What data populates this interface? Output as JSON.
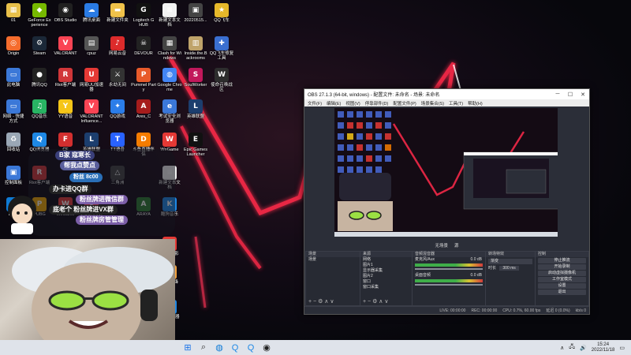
{
  "desktop": {
    "icons": [
      {
        "label": "01",
        "color": "#e8c04a",
        "glyph": "▦"
      },
      {
        "label": "GeForce Experience",
        "color": "#76b900",
        "glyph": "◆"
      },
      {
        "label": "OBS Studio",
        "color": "#202020",
        "glyph": "◉"
      },
      {
        "label": "腾讯桌面",
        "color": "#2a7be4",
        "glyph": "☁"
      },
      {
        "label": "新建文件夹",
        "color": "#f0c24a",
        "glyph": "▬"
      },
      {
        "label": "Logitech G HUB",
        "color": "#111111",
        "glyph": "G"
      },
      {
        "label": "新建文本文档",
        "color": "#f2f2f2",
        "glyph": "≡"
      },
      {
        "label": "20220515...",
        "color": "#444444",
        "glyph": "▣"
      },
      {
        "label": "QQ飞车",
        "color": "#e6b82a",
        "glyph": "★"
      },
      {
        "label": "Origin",
        "color": "#f56c2d",
        "glyph": "◎"
      },
      {
        "label": "Steam",
        "color": "#1b2838",
        "glyph": "⚙"
      },
      {
        "label": "VALORANT",
        "color": "#fa4454",
        "glyph": "V"
      },
      {
        "label": "cpuz",
        "color": "#555555",
        "glyph": "▤"
      },
      {
        "label": "网易云音",
        "color": "#dd2b2b",
        "glyph": "♪"
      },
      {
        "label": "DEVOUR",
        "color": "#222222",
        "glyph": "☠"
      },
      {
        "label": "Clash for Windows",
        "color": "#444444",
        "glyph": "▦"
      },
      {
        "label": "Inside.the.Backrooms",
        "color": "#bfa36a",
        "glyph": "▥"
      },
      {
        "label": "QQ飞车修复工具",
        "color": "#3a6fd0",
        "glyph": "✚"
      },
      {
        "label": "此电脑",
        "color": "#3b78d8",
        "glyph": "▭"
      },
      {
        "label": "腾讯QQ",
        "color": "#222222",
        "glyph": "●"
      },
      {
        "label": "Riot客户端",
        "color": "#d13639",
        "glyph": "R"
      },
      {
        "label": "网易UU加速器",
        "color": "#e53935",
        "glyph": "U"
      },
      {
        "label": "永劫无间",
        "color": "#333333",
        "glyph": "⚔"
      },
      {
        "label": "Pummel Party",
        "color": "#e85a2a",
        "glyph": "P"
      },
      {
        "label": "Google Chrome",
        "color": "#4285f4",
        "glyph": "◍"
      },
      {
        "label": "SoulWorker",
        "color": "#c2185b",
        "glyph": "S"
      },
      {
        "label": "使命召唤战区",
        "color": "#2d2d2d",
        "glyph": "W"
      },
      {
        "label": "网络 - 快捷方式",
        "color": "#3b78d8",
        "glyph": "▭"
      },
      {
        "label": "QQ音乐",
        "color": "#28b463",
        "glyph": "♫"
      },
      {
        "label": "YY语音",
        "color": "#f5c518",
        "glyph": "Y"
      },
      {
        "label": "VALORANT Influence...",
        "color": "#fa4454",
        "glyph": "V"
      },
      {
        "label": "QQ游戏",
        "color": "#2b7de9",
        "glyph": "✦"
      },
      {
        "label": "Ares_C",
        "color": "#a61c1c",
        "glyph": "A"
      },
      {
        "label": "考试安全浏览器",
        "color": "#3b78d8",
        "glyph": "e"
      },
      {
        "label": "英雄联盟",
        "color": "#1c3e6e",
        "glyph": "L"
      },
      {
        "label": "回收站",
        "color": "#9aa7b5",
        "glyph": "♻"
      },
      {
        "label": "QQ浏览器",
        "color": "#1e88e5",
        "glyph": "Q"
      },
      {
        "label": "CF",
        "color": "#d32f2f",
        "glyph": "F"
      },
      {
        "label": "英雄联盟",
        "color": "#1c3e6e",
        "glyph": "L"
      },
      {
        "label": "TT语音",
        "color": "#2962ff",
        "glyph": "T"
      },
      {
        "label": "斗鱼直播伴侣",
        "color": "#f57c00",
        "glyph": "D"
      },
      {
        "label": "WeGame",
        "color": "#e53935",
        "glyph": "W"
      },
      {
        "label": "Epic Games Launcher",
        "color": "#111111",
        "glyph": "E"
      },
      {
        "label": "控制面板",
        "color": "#3b78d8",
        "glyph": "▣"
      },
      {
        "label": "Riot客户端",
        "color": "#d13639",
        "glyph": "R"
      },
      {
        "label": "三角洲",
        "color": "#444444",
        "glyph": "△"
      },
      {
        "label": "新建文本文档",
        "color": "#f2f2f2",
        "glyph": "≡"
      },
      {
        "label": "Edge",
        "color": "#0f7bd6",
        "glyph": "e"
      },
      {
        "label": "PUBG",
        "color": "#f2a900",
        "glyph": "P"
      },
      {
        "label": "WeGame",
        "color": "#e53935",
        "glyph": "W"
      },
      {
        "label": "VALORANT Influence...",
        "color": "#fa4454",
        "glyph": "V"
      },
      {
        "label": "ARAYA",
        "color": "#2e7d32",
        "glyph": "A"
      },
      {
        "label": "酷狗音乐",
        "color": "#1e88e5",
        "glyph": "K"
      },
      {
        "label": "金刚4K影",
        "color": "#e53935",
        "glyph": "▶"
      },
      {
        "label": "守望先锋",
        "color": "#f4a340",
        "glyph": "◕"
      },
      {
        "label": "QQ浏览器",
        "color": "#1e88e5",
        "glyph": "Q"
      }
    ]
  },
  "overlay": {
    "header": "B家 寇寒长",
    "subheader": "帮我点赞点",
    "fan_badge": "粉丝 8c00",
    "lines": [
      "办卡进QQ群",
      "粉丝牌进微信群",
      "底老个 粉丝牌进VX群",
      "粉丝牌房管管理"
    ]
  },
  "obs": {
    "title": "OBS 27.1.3 (64-bit, windows) - 配置文件: 未命名 - 场景: 未命名",
    "menu": [
      "文件(F)",
      "编辑(E)",
      "视图(V)",
      "停靠部件(D)",
      "配置文件(P)",
      "场景集合(S)",
      "工具(T)",
      "帮助(H)"
    ],
    "scene_bar": {
      "none": "无场景",
      "status": "源"
    },
    "docks": {
      "scenes": {
        "title": "场景",
        "items": [
          "场景"
        ]
      },
      "sources": {
        "title": "来源",
        "items": [
          "网络",
          "图片1",
          "显示器采集",
          "图片2",
          "窗口",
          "窗口采集",
          "显示器采集"
        ]
      },
      "mixer": {
        "title": "音频混音器",
        "tracks": [
          {
            "name": "麦克风/Aux",
            "level": "0.0 dB"
          },
          {
            "name": "桌面音频",
            "level": "0.0 dB"
          }
        ]
      },
      "transitions": {
        "title": "转场特效",
        "type": "渐变",
        "duration_label": "时长",
        "duration": "300 ms"
      },
      "controls": {
        "title": "控制",
        "buttons": [
          "停止推流",
          "开始录制",
          "启动虚拟摄像机",
          "工作室模式",
          "设置",
          "退出"
        ]
      }
    },
    "status": [
      "LIVE: 00:00:00",
      "REC: 00:00:00",
      "CPU: 0.7%, 60.00 fps",
      "延迟 0 (0.0%)",
      "kb/s 0"
    ]
  },
  "taskbar": {
    "pinned": [
      "windows",
      "search",
      "edge",
      "qq",
      "qq2",
      "obs"
    ],
    "time": "15:24",
    "date": "2022/11/18"
  }
}
